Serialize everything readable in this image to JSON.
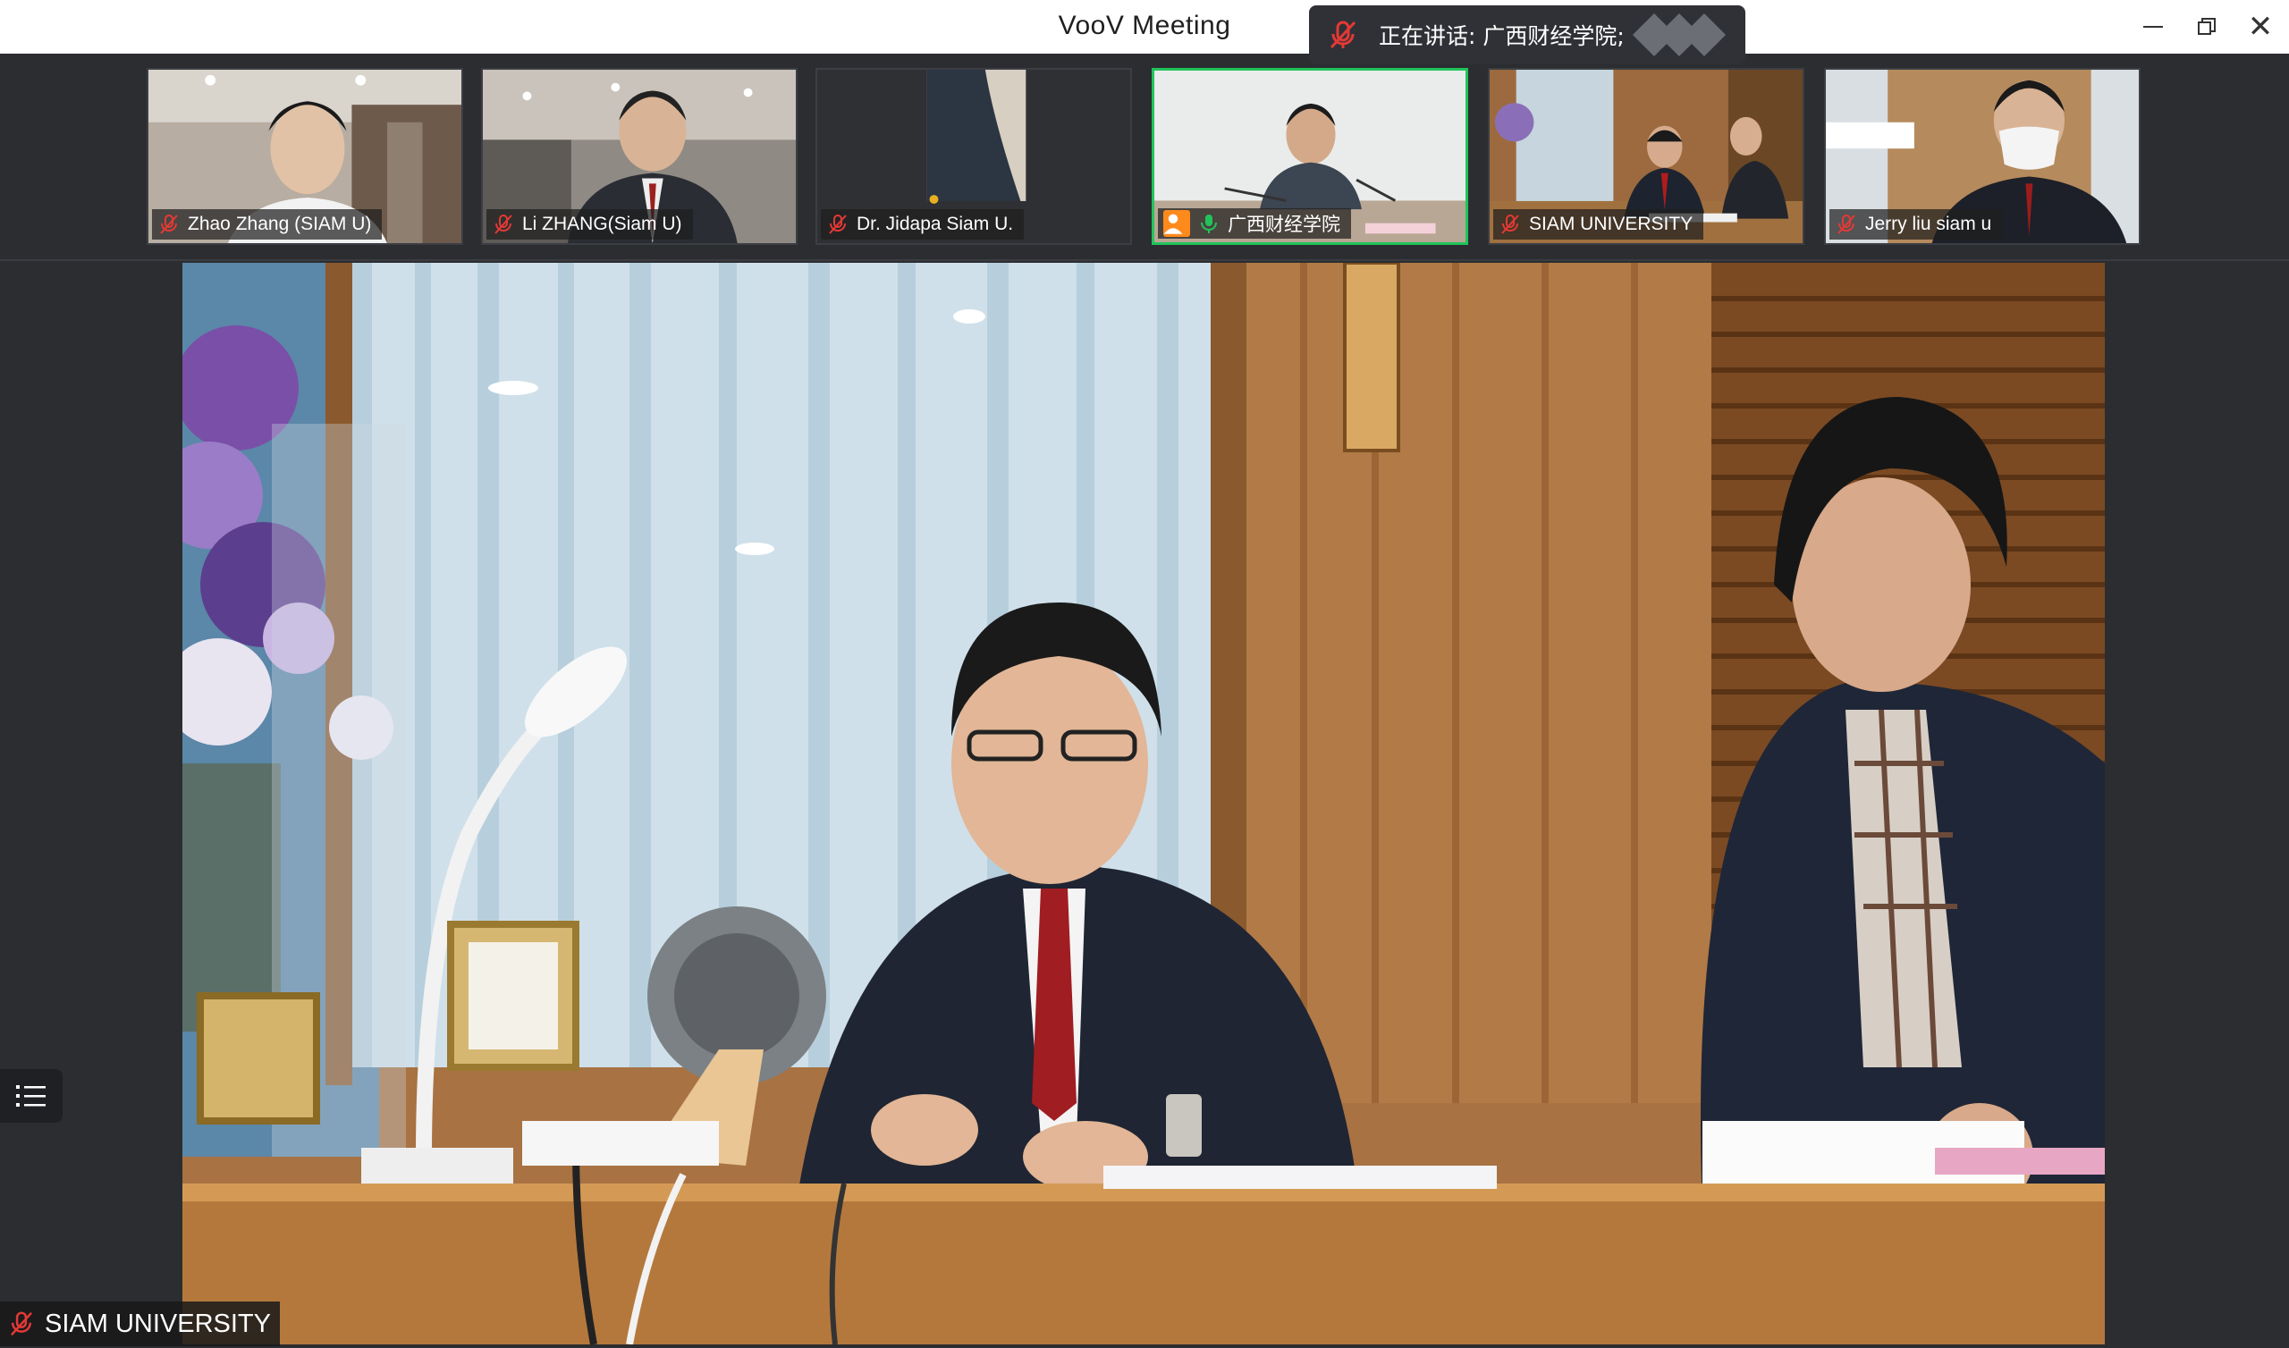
{
  "window": {
    "title": "VooV Meeting"
  },
  "speaking_banner": {
    "label": "正在讲话: 广西财经学院;"
  },
  "participants": [
    {
      "name": "Zhao Zhang (SIAM U)",
      "muted": true
    },
    {
      "name": "Li ZHANG(Siam U)",
      "muted": true
    },
    {
      "name": "Dr. Jidapa Siam U.",
      "muted": true
    },
    {
      "name": "广西财经学院",
      "muted": false,
      "speaking": true,
      "host": true
    },
    {
      "name": "SIAM UNIVERSITY",
      "muted": true
    },
    {
      "name": "Jerry liu siam u",
      "muted": true
    }
  ],
  "main_view": {
    "name": "SIAM UNIVERSITY",
    "muted": true
  },
  "colors": {
    "mute_red": "#e53935",
    "active_green": "#21c45a",
    "host_orange": "#ff8a1c"
  }
}
